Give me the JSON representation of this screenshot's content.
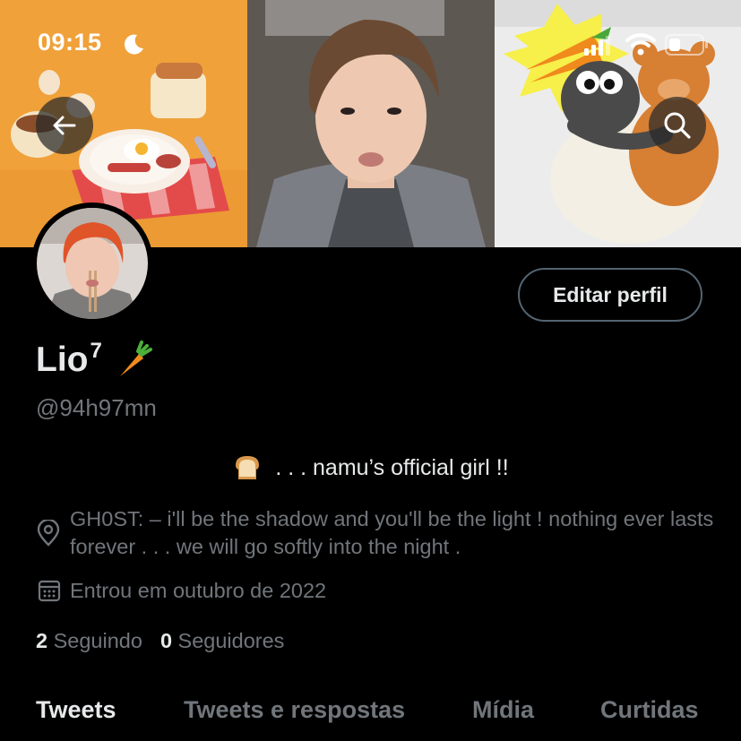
{
  "status_bar": {
    "time": "09:15"
  },
  "profile": {
    "display_name": "Lio",
    "name_superscript": "7",
    "handle": "@94h97mn",
    "edit_button": "Editar perfil",
    "bio": ". . . namu’s official girl !!",
    "location": "GH0ST: – i'll be the shadow and you'll be the light ! nothing ever lasts forever . . . we will go softly into the night .",
    "joined": "Entrou em outubro de 2022",
    "following_count": "2",
    "following_label": "Seguindo",
    "followers_count": "0",
    "followers_label": "Seguidores"
  },
  "tabs": [
    {
      "label": "Tweets",
      "active": true
    },
    {
      "label": "Tweets e respostas",
      "active": false
    },
    {
      "label": "Mídia",
      "active": false
    },
    {
      "label": "Curtidas",
      "active": false
    }
  ],
  "icons": {
    "back": "arrow-left-icon",
    "search": "search-icon",
    "location": "location-pin-icon",
    "calendar": "calendar-icon"
  },
  "colors": {
    "background": "#000000",
    "text_primary": "#e7e9ea",
    "text_secondary": "#71767b",
    "button_border": "#536471"
  }
}
